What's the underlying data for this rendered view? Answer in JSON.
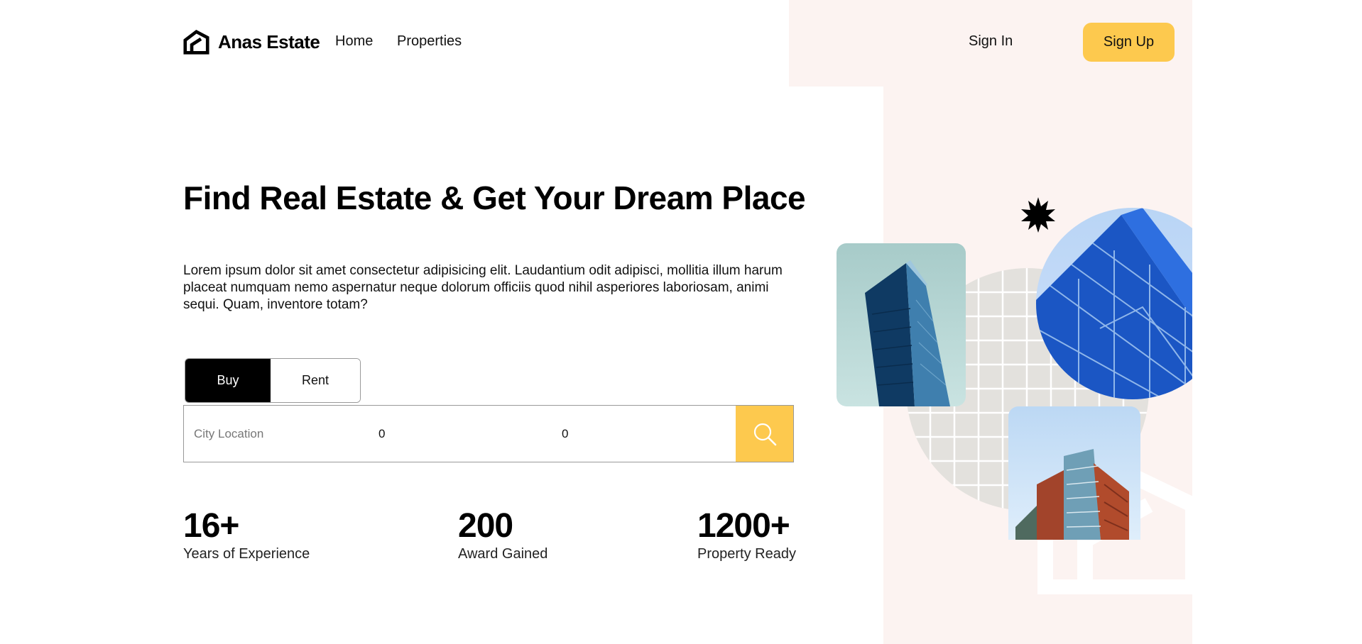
{
  "brand": {
    "name": "Anas Estate",
    "logo_icon": "house-logo-icon"
  },
  "nav": {
    "home": "Home",
    "properties": "Properties"
  },
  "auth": {
    "sign_in": "Sign In",
    "sign_up": "Sign Up"
  },
  "hero": {
    "title": "Find Real Estate & Get Your Dream Place",
    "description": "Lorem ipsum dolor sit amet consectetur adipisicing elit. Laudantium odit adipisci, mollitia illum harum placeat numquam nemo aspernatur neque dolorum officiis quod nihil asperiores laboriosam, animi sequi. Quam, inventore totam?"
  },
  "search": {
    "tabs": [
      {
        "label": "Buy",
        "active": true
      },
      {
        "label": "Rent",
        "active": false
      }
    ],
    "city_placeholder": "City Location",
    "min_price_value": "0",
    "max_price_value": "0",
    "submit_icon": "search-icon"
  },
  "stats": [
    {
      "value": "16+",
      "label": "Years of Experience"
    },
    {
      "value": "200",
      "label": "Award Gained"
    },
    {
      "value": "1200+",
      "label": "Property Ready"
    }
  ],
  "colors": {
    "accent": "#fdc94e",
    "panel": "#fcf3f1",
    "active_tab": "#000000",
    "grid_circle": "#e3e1dd"
  }
}
